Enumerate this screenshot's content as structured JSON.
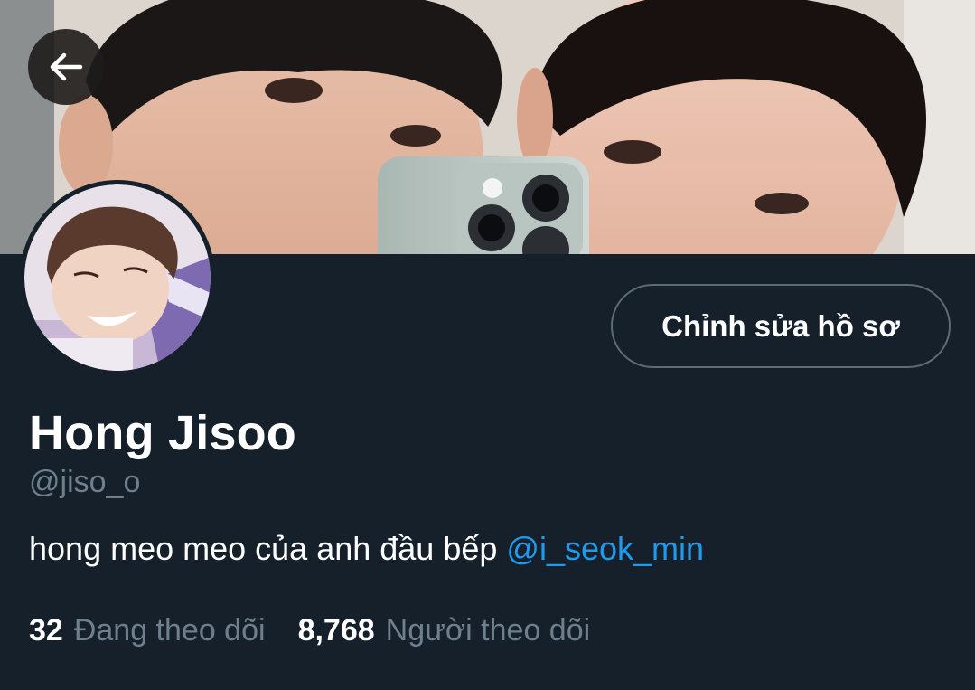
{
  "profile": {
    "name": "Hong Jisoo",
    "handle": "@jiso_o",
    "bio_text": "hong meo meo của anh đầu bếp ",
    "bio_mention": "@i_seok_min",
    "edit_button_label": "Chỉnh sửa hồ sơ"
  },
  "stats": {
    "following_count": "32",
    "following_label": "Đang theo dõi",
    "followers_count": "8,768",
    "followers_label": "Người theo dõi"
  },
  "icons": {
    "back": "arrow-left-icon"
  },
  "colors": {
    "background": "#15202b",
    "accent": "#1d9bf0",
    "secondary_text": "#6e7f8e"
  }
}
